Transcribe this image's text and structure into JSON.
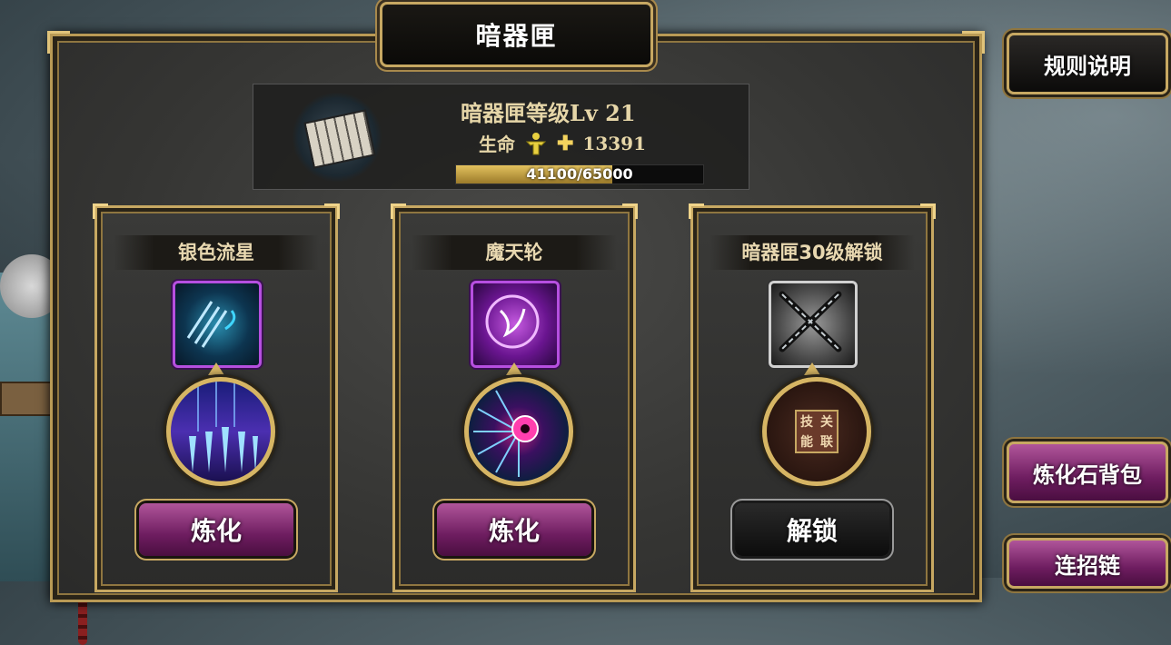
{
  "header": {
    "title": "暗器匣"
  },
  "side_buttons": {
    "rules": "规则说明",
    "bag": "炼化石背包",
    "chain": "连招链"
  },
  "info": {
    "level_text": "暗器匣等级Lv 21",
    "hp_label": "生命",
    "hp_bonus": "13391",
    "exp_text": "41100/65000",
    "exp_current": 41100,
    "exp_max": 65000
  },
  "cards": [
    {
      "title": "银色流星",
      "button": "炼化",
      "skill_icon": "silver-meteor-icon",
      "orb_icon": "blade-rain-icon"
    },
    {
      "title": "魔天轮",
      "button": "炼化",
      "skill_icon": "demon-wheel-icon",
      "orb_icon": "eye-wheel-icon"
    },
    {
      "title": "暗器匣30级解锁",
      "button": "解锁",
      "skill_icon": "crossed-chains-icon",
      "orb_icon": "combo-seal-icon",
      "seal_chars": [
        "技",
        "关",
        "能",
        "联"
      ]
    }
  ],
  "colors": {
    "gold_border": "#c7a862",
    "refine_button": "#8a2f7a",
    "exp_fill": "#d6b453"
  }
}
